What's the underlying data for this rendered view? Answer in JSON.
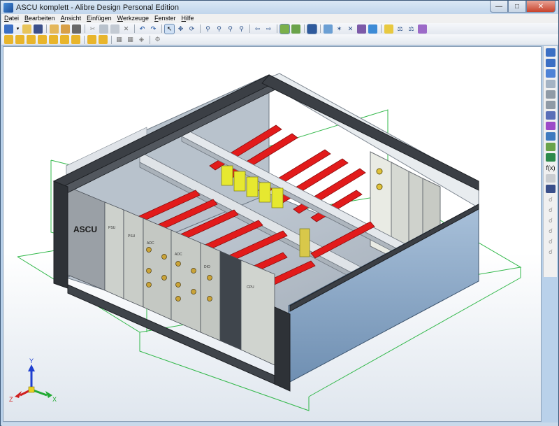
{
  "window": {
    "title": "ASCU komplett - Alibre Design Personal Edition"
  },
  "menu": {
    "items": [
      {
        "label": "Datei",
        "accel": "D",
        "rest": "atei"
      },
      {
        "label": "Bearbeiten",
        "accel": "B",
        "rest": "earbeiten"
      },
      {
        "label": "Ansicht",
        "accel": "A",
        "rest": "nsicht"
      },
      {
        "label": "Einfügen",
        "accel": "E",
        "rest": "infügen"
      },
      {
        "label": "Werkzeuge",
        "accel": "W",
        "rest": "erkzeuge"
      },
      {
        "label": "Fenster",
        "accel": "F",
        "rest": "enster"
      },
      {
        "label": "Hilfe",
        "accel": "H",
        "rest": "ilfe"
      }
    ]
  },
  "side_toolbar": {
    "fx_label": "f(x)"
  },
  "model": {
    "front_panel_title": "ASCU",
    "module_labels": [
      "ASCU",
      "PSU",
      "PSU",
      "ADC",
      "ADC",
      "DIO",
      "CPU"
    ]
  },
  "colors": {
    "rail_red": "#e21b1b",
    "connector_yellow": "#e6e830",
    "frame_dark": "#3b3f45",
    "rack_gray": "#9fa3a8",
    "panel_blue": "#7c9cbf",
    "bbox_green": "#32b84a"
  },
  "triad": {
    "x_label": "X",
    "y_label": "Y",
    "z_label": "Z"
  }
}
